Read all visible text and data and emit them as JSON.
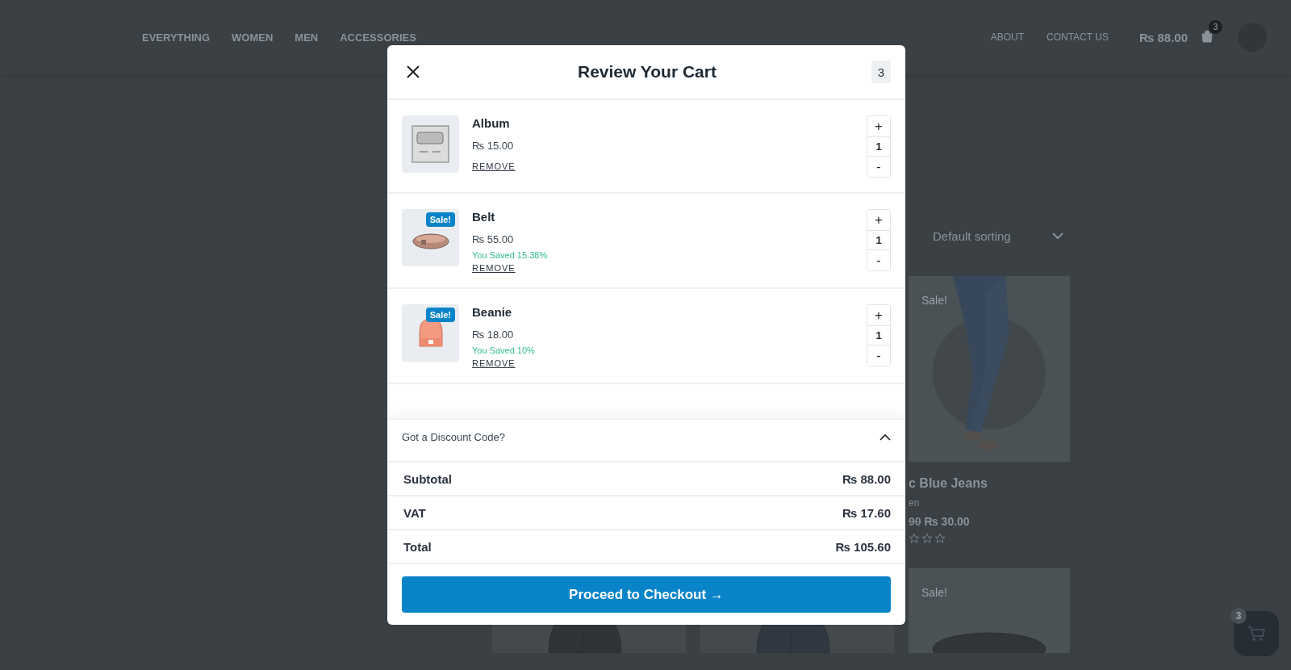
{
  "header": {
    "nav": [
      "EVERYTHING",
      "WOMEN",
      "MEN",
      "ACCESSORIES"
    ],
    "links": [
      "ABOUT",
      "CONTACT US"
    ],
    "cart_total": "₨ 88.00",
    "cart_count": "3"
  },
  "shop": {
    "sorting": "Default sorting",
    "product": {
      "badge": "Sale!",
      "title": "c Blue Jeans",
      "category": "en",
      "old_price": "90",
      "price": "₨ 30.00",
      "stars": 0
    },
    "next_row_badge": "Sale!"
  },
  "cart_modal": {
    "title": "Review Your Cart",
    "count": "3",
    "items": [
      {
        "name": "Album",
        "price": "₨ 15.00",
        "remove": "REMOVE",
        "quantity": "1",
        "plus": "+",
        "minus": "-"
      },
      {
        "name": "Belt",
        "badge": "Sale!",
        "price": "₨ 55.00",
        "saved": "You Saved 15.38%",
        "remove": "REMOVE",
        "quantity": "1",
        "plus": "+",
        "minus": "-"
      },
      {
        "name": "Beanie",
        "badge": "Sale!",
        "price": "₨ 18.00",
        "saved": "You Saved 10%",
        "remove": "REMOVE",
        "quantity": "1",
        "plus": "+",
        "minus": "-"
      }
    ],
    "discount": {
      "label": "Got a Discount Code?",
      "expanded": true
    },
    "totals": [
      {
        "label": "Subtotal",
        "value": "₨ 88.00"
      },
      {
        "label": "VAT",
        "value": "₨ 17.60"
      },
      {
        "label": "Total",
        "value": "₨ 105.60"
      }
    ],
    "checkout": "Proceed to Checkout →"
  },
  "floating_cart": {
    "count": "3"
  }
}
